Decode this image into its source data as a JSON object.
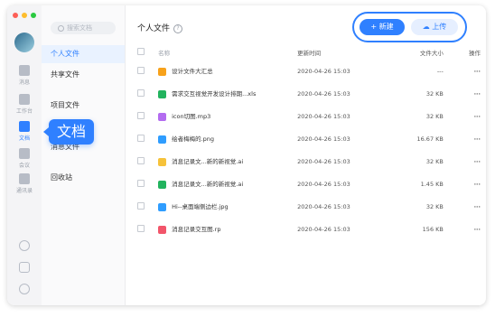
{
  "rail": {
    "items": [
      {
        "label": "消息"
      },
      {
        "label": "工作台"
      },
      {
        "label": "文档"
      },
      {
        "label": "会议"
      },
      {
        "label": "通讯录"
      }
    ]
  },
  "callout": "文档",
  "nav": {
    "search_placeholder": "搜索文档",
    "items": [
      {
        "label": "个人文件"
      },
      {
        "label": "共享文件"
      },
      {
        "label": "项目文件"
      },
      {
        "label": "消息文件"
      },
      {
        "label": "回收站"
      }
    ]
  },
  "main": {
    "title": "个人文件",
    "new_button": "新建",
    "upload_button": "上传",
    "columns": {
      "name": "名称",
      "time": "更新时间",
      "size": "文件大小",
      "op": "操作"
    },
    "rows": [
      {
        "name": "设计文件大汇总",
        "time": "2020-04-26 15:03",
        "size": "---",
        "type": "folder",
        "color": "#f7a21b"
      },
      {
        "name": "需求交互视觉开发设计排期...xls",
        "time": "2020-04-26 15:03",
        "size": "32 KB",
        "type": "excel",
        "color": "#22b35e"
      },
      {
        "name": "icon切图.mp3",
        "time": "2020-04-26 15:03",
        "size": "32 KB",
        "type": "audio",
        "color": "#b36cf0"
      },
      {
        "name": "绘者梅梅的.png",
        "time": "2020-04-26 15:03",
        "size": "16.67 KB",
        "type": "image",
        "color": "#2f9dff"
      },
      {
        "name": "消息记录文...新的新视觉.ai",
        "time": "2020-04-26 15:03",
        "size": "32 KB",
        "type": "ai",
        "color": "#f6c23a"
      },
      {
        "name": "消息记录文...新的新视觉.ai",
        "time": "2020-04-26 15:03",
        "size": "1.45 KB",
        "type": "excel",
        "color": "#22b35e"
      },
      {
        "name": "Hi--桌面端侧边栏.jpg",
        "time": "2020-04-26 15:03",
        "size": "32 KB",
        "type": "image",
        "color": "#2f9dff"
      },
      {
        "name": "消息记录交互图.rp",
        "time": "2020-04-26 15:03",
        "size": "156 KB",
        "type": "rp",
        "color": "#f2556a"
      }
    ],
    "more": "···"
  },
  "colors": {
    "accent": "#2f80ff"
  }
}
